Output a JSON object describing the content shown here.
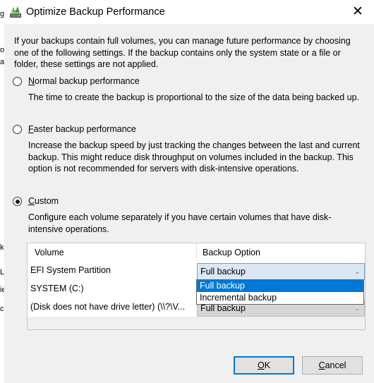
{
  "background_fragments": [
    "g",
    "ol",
    "ar",
    "k",
    "L",
    "ie",
    "c"
  ],
  "window": {
    "title": "Optimize Backup Performance",
    "close_glyph": "✕"
  },
  "intro_text": "If your backups contain full volumes, you can manage future performance by choosing one of the following settings. If the backup contains only the system state or a file or folder, these settings are not applied.",
  "options": [
    {
      "label_mnemonic": "N",
      "label_rest": "ormal backup performance",
      "selected": false,
      "description": "The time to create the backup is proportional to the size of the data being backed up."
    },
    {
      "label_mnemonic": "F",
      "label_rest": "aster backup performance",
      "selected": false,
      "description": "Increase the backup speed by just tracking the changes between the last and current backup.  This might reduce disk throughput on volumes included in the backup. This option is not recommended for servers with disk-intensive operations."
    },
    {
      "label_mnemonic": "C",
      "label_rest": "ustom",
      "selected": true,
      "description": "Configure each volume separately if you have certain volumes that have disk-intensive operations."
    }
  ],
  "grid": {
    "columns": [
      "Volume",
      "Backup Option"
    ],
    "rows": [
      {
        "volume": "EFI System Partition",
        "option": "Full backup"
      },
      {
        "volume": "SYSTEM (C:)",
        "option": "Full backup"
      },
      {
        "volume": "(Disk does not have drive letter) (\\\\?\\V...",
        "option": "Full backup"
      }
    ]
  },
  "dropdown": {
    "items": [
      "Full backup",
      "Incremental backup"
    ],
    "selected": "Full backup"
  },
  "buttons": {
    "ok_mnemonic": "O",
    "ok_rest": "K",
    "cancel_mnemonic": "C",
    "cancel_rest": "ancel"
  },
  "colors": {
    "selection": "#0078d7",
    "dialog_bg": "#f0f0f0",
    "combo_bg": "#dbe7f5"
  }
}
